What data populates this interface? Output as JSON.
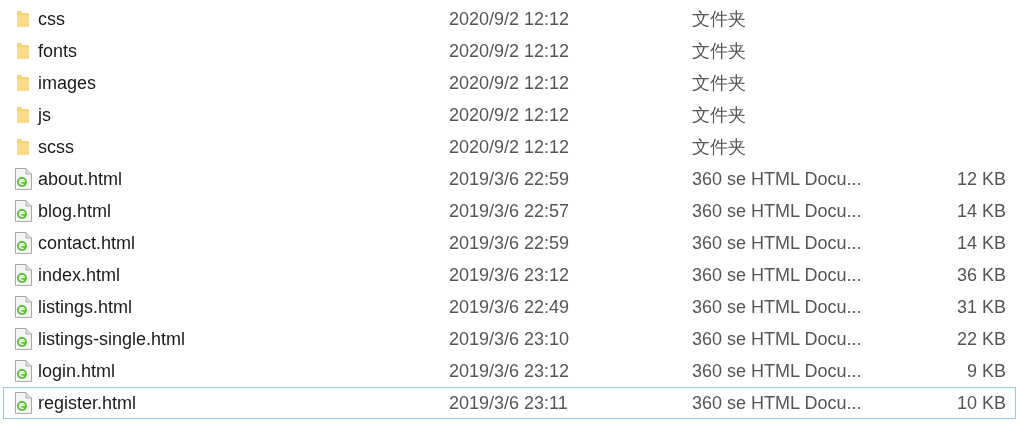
{
  "files": [
    {
      "kind": "folder",
      "name": "css",
      "date": "2020/9/2 12:12",
      "type": "文件夹",
      "selected": false
    },
    {
      "kind": "folder",
      "name": "fonts",
      "date": "2020/9/2 12:12",
      "type": "文件夹",
      "selected": false
    },
    {
      "kind": "folder",
      "name": "images",
      "date": "2020/9/2 12:12",
      "type": "文件夹",
      "selected": false
    },
    {
      "kind": "folder",
      "name": "js",
      "date": "2020/9/2 12:12",
      "type": "文件夹",
      "selected": false
    },
    {
      "kind": "folder",
      "name": "scss",
      "date": "2020/9/2 12:12",
      "type": "文件夹",
      "selected": false
    },
    {
      "kind": "file",
      "name": "about.html",
      "date": "2019/3/6 22:59",
      "type": "360 se HTML Docu...",
      "size": "12 KB",
      "selected": false
    },
    {
      "kind": "file",
      "name": "blog.html",
      "date": "2019/3/6 22:57",
      "type": "360 se HTML Docu...",
      "size": "14 KB",
      "selected": false
    },
    {
      "kind": "file",
      "name": "contact.html",
      "date": "2019/3/6 22:59",
      "type": "360 se HTML Docu...",
      "size": "14 KB",
      "selected": false
    },
    {
      "kind": "file",
      "name": "index.html",
      "date": "2019/3/6 23:12",
      "type": "360 se HTML Docu...",
      "size": "36 KB",
      "selected": false
    },
    {
      "kind": "file",
      "name": "listings.html",
      "date": "2019/3/6 22:49",
      "type": "360 se HTML Docu...",
      "size": "31 KB",
      "selected": false
    },
    {
      "kind": "file",
      "name": "listings-single.html",
      "date": "2019/3/6 23:10",
      "type": "360 se HTML Docu...",
      "size": "22 KB",
      "selected": false
    },
    {
      "kind": "file",
      "name": "login.html",
      "date": "2019/3/6 23:12",
      "type": "360 se HTML Docu...",
      "size": "9 KB",
      "selected": false
    },
    {
      "kind": "file",
      "name": "register.html",
      "date": "2019/3/6 23:11",
      "type": "360 se HTML Docu...",
      "size": "10 KB",
      "selected": true
    }
  ]
}
